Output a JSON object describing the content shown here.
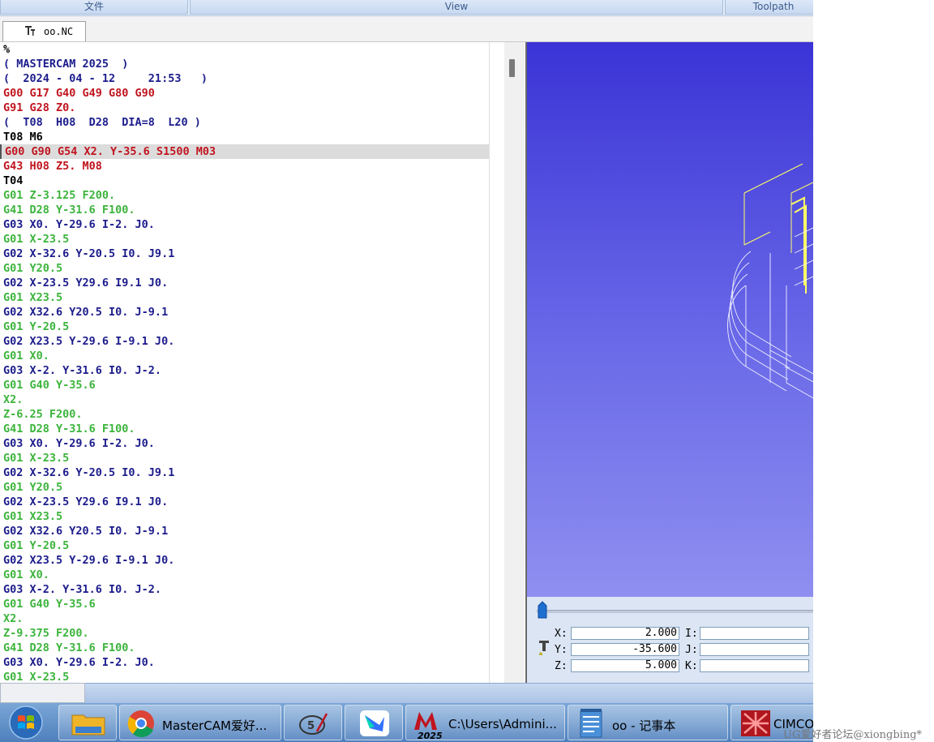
{
  "ribbon": {
    "groups": [
      "文件",
      "View",
      "Toolpath"
    ]
  },
  "tab": {
    "label": "oo.NC",
    "icon": "tool-holder-icon"
  },
  "code": [
    {
      "text": "%",
      "color": "#000000"
    },
    {
      "text": "( MASTERCAM 2025  )",
      "color": "#1c1c8c"
    },
    {
      "text": "(  2024 - 04 - 12     21:53   )",
      "color": "#1c1c8c"
    },
    {
      "text": "G00 G17 G40 G49 G80 G90",
      "color": "#c0141e"
    },
    {
      "text": "G91 G28 Z0.",
      "color": "#c0141e"
    },
    {
      "text": "(  T08  H08  D28  DIA=8  L20 )",
      "color": "#1c1c8c"
    },
    {
      "text": "T08 M6",
      "color": "#000000"
    },
    {
      "text": "G00 G90 G54 X2. Y-35.6 S1500 M03",
      "color": "#c0141e",
      "current": true
    },
    {
      "text": "G43 H08 Z5. M08",
      "color": "#c0141e"
    },
    {
      "text": "T04",
      "color": "#000000"
    },
    {
      "text": "G01 Z-3.125 F200.",
      "color": "#3cb43c"
    },
    {
      "text": "G41 D28 Y-31.6 F100.",
      "color": "#3cb43c"
    },
    {
      "text": "G03 X0. Y-29.6 I-2. J0.",
      "color": "#1c1c8c"
    },
    {
      "text": "G01 X-23.5",
      "color": "#3cb43c"
    },
    {
      "text": "G02 X-32.6 Y-20.5 I0. J9.1",
      "color": "#1c1c8c"
    },
    {
      "text": "G01 Y20.5",
      "color": "#3cb43c"
    },
    {
      "text": "G02 X-23.5 Y29.6 I9.1 J0.",
      "color": "#1c1c8c"
    },
    {
      "text": "G01 X23.5",
      "color": "#3cb43c"
    },
    {
      "text": "G02 X32.6 Y20.5 I0. J-9.1",
      "color": "#1c1c8c"
    },
    {
      "text": "G01 Y-20.5",
      "color": "#3cb43c"
    },
    {
      "text": "G02 X23.5 Y-29.6 I-9.1 J0.",
      "color": "#1c1c8c"
    },
    {
      "text": "G01 X0.",
      "color": "#3cb43c"
    },
    {
      "text": "G03 X-2. Y-31.6 I0. J-2.",
      "color": "#1c1c8c"
    },
    {
      "text": "G01 G40 Y-35.6",
      "color": "#3cb43c"
    },
    {
      "text": "X2.",
      "color": "#3cb43c"
    },
    {
      "text": "Z-6.25 F200.",
      "color": "#3cb43c"
    },
    {
      "text": "G41 D28 Y-31.6 F100.",
      "color": "#3cb43c"
    },
    {
      "text": "G03 X0. Y-29.6 I-2. J0.",
      "color": "#1c1c8c"
    },
    {
      "text": "G01 X-23.5",
      "color": "#3cb43c"
    },
    {
      "text": "G02 X-32.6 Y-20.5 I0. J9.1",
      "color": "#1c1c8c"
    },
    {
      "text": "G01 Y20.5",
      "color": "#3cb43c"
    },
    {
      "text": "G02 X-23.5 Y29.6 I9.1 J0.",
      "color": "#1c1c8c"
    },
    {
      "text": "G01 X23.5",
      "color": "#3cb43c"
    },
    {
      "text": "G02 X32.6 Y20.5 I0. J-9.1",
      "color": "#1c1c8c"
    },
    {
      "text": "G01 Y-20.5",
      "color": "#3cb43c"
    },
    {
      "text": "G02 X23.5 Y-29.6 I-9.1 J0.",
      "color": "#1c1c8c"
    },
    {
      "text": "G01 X0.",
      "color": "#3cb43c"
    },
    {
      "text": "G03 X-2. Y-31.6 I0. J-2.",
      "color": "#1c1c8c"
    },
    {
      "text": "G01 G40 Y-35.6",
      "color": "#3cb43c"
    },
    {
      "text": "X2.",
      "color": "#3cb43c"
    },
    {
      "text": "Z-9.375 F200.",
      "color": "#3cb43c"
    },
    {
      "text": "G41 D28 Y-31.6 F100.",
      "color": "#3cb43c"
    },
    {
      "text": "G03 X0. Y-29.6 I-2. J0.",
      "color": "#1c1c8c"
    },
    {
      "text": "G01 X-23.5",
      "color": "#3cb43c"
    }
  ],
  "coords": {
    "x_label": "X:",
    "x_value": "2.000",
    "y_label": "Y:",
    "y_value": "-35.600",
    "z_label": "Z:",
    "z_value": "5.000",
    "i_label": "I:",
    "i_value": "",
    "j_label": "J:",
    "j_value": "",
    "k_label": "K:",
    "k_value": ""
  },
  "taskbar": {
    "start": "windows-start-icon",
    "items": [
      {
        "name": "explorer",
        "icon": "folder-icon",
        "label": ""
      },
      {
        "name": "browser",
        "icon": "browser-icon",
        "label": "MasterCAM爱好..."
      },
      {
        "name": "app-5",
        "icon": "pen-app-icon",
        "label": ""
      },
      {
        "name": "feishu",
        "icon": "bird-icon",
        "label": ""
      },
      {
        "name": "mastercam",
        "icon": "mastercam-icon",
        "label": "C:\\Users\\Admini...",
        "badge": "2025"
      },
      {
        "name": "notepad",
        "icon": "notepad-icon",
        "label": "oo - 记事本"
      },
      {
        "name": "cimco",
        "icon": "cimco-icon",
        "label": "CIMCO"
      }
    ]
  },
  "watermark": "UG爱好者论坛@xiongbing*",
  "colors": {
    "comment": "#1c1c8c",
    "modal": "#c0141e",
    "motion": "#3cb43c",
    "arc": "#1c1c8c",
    "viewport_top": "#3b33d6",
    "viewport_bottom": "#8f8ff0"
  }
}
